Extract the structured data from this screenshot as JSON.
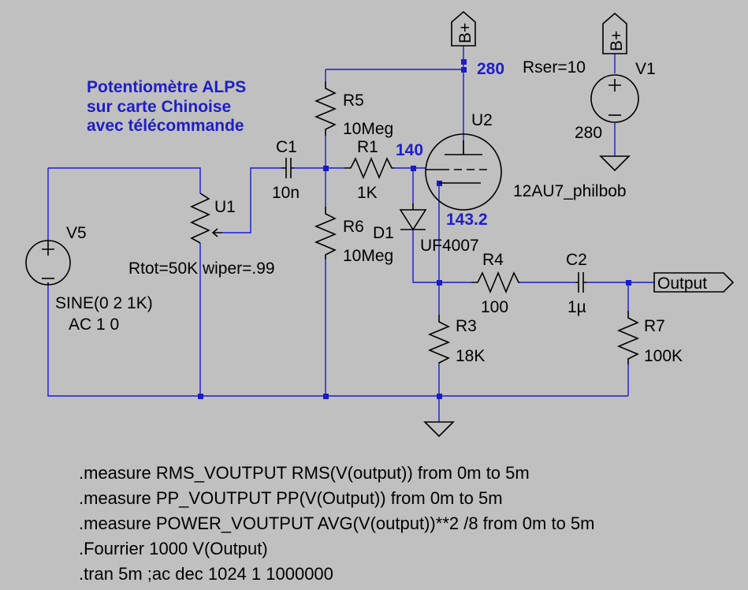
{
  "note": {
    "line1": "Potentiomètre ALPS",
    "line2": "sur carte Chinoise",
    "line3": "avec télécommande"
  },
  "components": {
    "c1": {
      "name": "C1",
      "value": "10n"
    },
    "r1": {
      "name": "R1",
      "value": "1K"
    },
    "r5": {
      "name": "R5",
      "value": "10Meg"
    },
    "r6": {
      "name": "R6",
      "value": "10Meg"
    },
    "r3": {
      "name": "R3",
      "value": "18K"
    },
    "r4": {
      "name": "R4",
      "value": "100"
    },
    "r7": {
      "name": "R7",
      "value": "100K"
    },
    "c2": {
      "name": "C2",
      "value": "1µ"
    },
    "d1": {
      "name": "D1",
      "value": "UF4007"
    },
    "u1": {
      "name": "U1",
      "value": "Rtot=50K wiper=.99"
    },
    "u2": {
      "name": "U2",
      "value": "12AU7_philbob"
    },
    "v5": {
      "name": "V5",
      "value1": "SINE(0 2 1K)",
      "value2": "AC 1 0"
    },
    "v1": {
      "name": "V1",
      "rser": "Rser=10",
      "value": "280"
    }
  },
  "ports": {
    "bplus": "B+",
    "output": "Output"
  },
  "node_voltages": {
    "plate": "280",
    "grid": "140",
    "cathode": "143.2"
  },
  "directives": [
    ".measure RMS_VOUTPUT RMS(V(output)) from 0m to 5m",
    ".measure PP_VOUTPUT PP(V(Output)) from 0m to 5m",
    ".measure POWER_VOUTPUT AVG(V(output))**2 /8 from 0m to 5m",
    ".Fourrier 1000 V(Output)",
    ".tran 5m ;ac dec 1024 1 1000000"
  ],
  "colors": {
    "background": "#c0c0c0",
    "wire": "#1a1ad0",
    "annotation": "#1e1ec8",
    "symbol": "#000000"
  }
}
